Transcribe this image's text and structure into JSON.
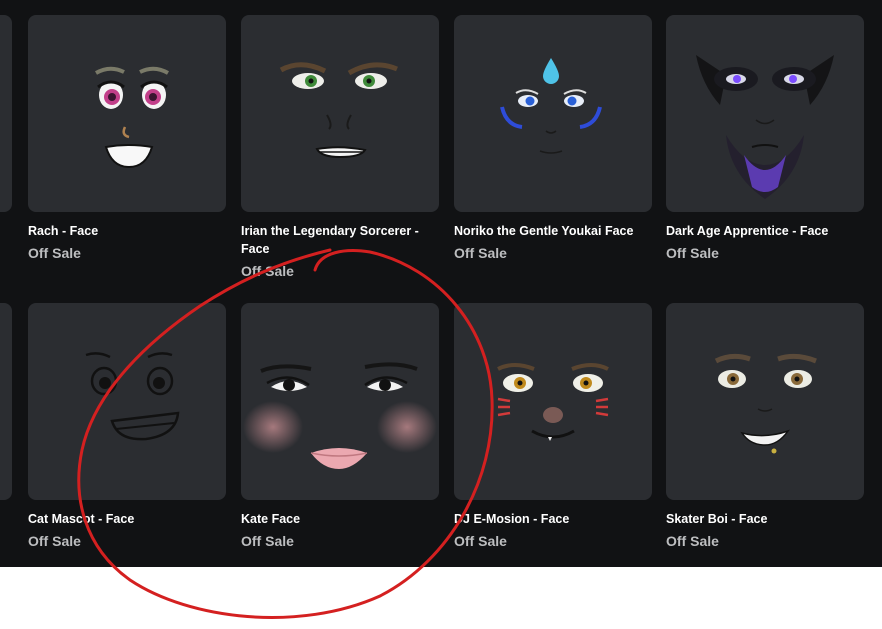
{
  "items": [
    {
      "name": "Rach - Face",
      "price": "Off Sale"
    },
    {
      "name": "Irian the Legendary Sorcerer - Face",
      "price": "Off Sale"
    },
    {
      "name": "Noriko the Gentle Youkai Face",
      "price": "Off Sale"
    },
    {
      "name": "Dark Age Apprentice - Face",
      "price": "Off Sale"
    },
    {
      "name": "Cat Mascot - Face",
      "price": "Off Sale"
    },
    {
      "name": "Kate Face",
      "price": "Off Sale"
    },
    {
      "name": "DJ E-Mosion - Face",
      "price": "Off Sale"
    },
    {
      "name": "Skater Boi - Face",
      "price": "Off Sale"
    }
  ],
  "colors": {
    "background": "#111214",
    "card": "#2b2d31",
    "annotation": "#d42020"
  }
}
